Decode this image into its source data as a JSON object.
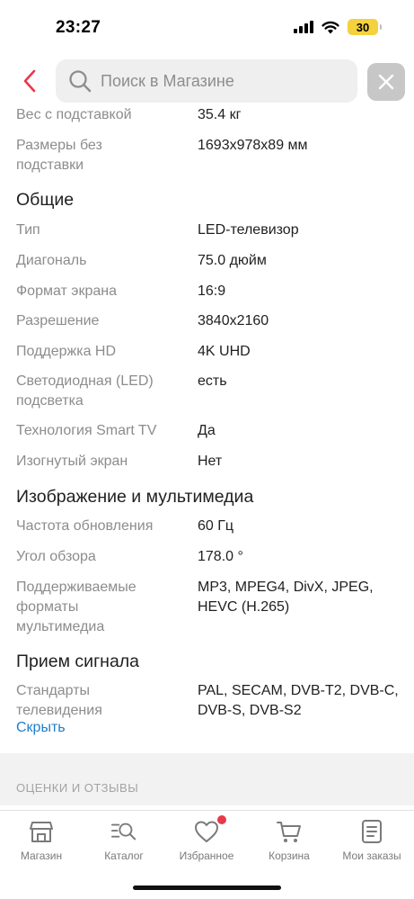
{
  "status_bar": {
    "time": "23:27",
    "battery": "30"
  },
  "header": {
    "search_placeholder": "Поиск в Магазине"
  },
  "specs_top": [
    {
      "label": "Вес с подставкой",
      "value": "35.4 кг"
    },
    {
      "label": "Размеры без подставки",
      "value": "1693x978x89 мм"
    }
  ],
  "sections": [
    {
      "title": "Общие",
      "rows": [
        {
          "label": "Тип",
          "value": "LED-телевизор"
        },
        {
          "label": "Диагональ",
          "value": "75.0 дюйм"
        },
        {
          "label": "Формат экрана",
          "value": "16:9"
        },
        {
          "label": "Разрешение",
          "value": "3840x2160"
        },
        {
          "label": "Поддержка HD",
          "value": "4K UHD"
        },
        {
          "label": "Светодиодная (LED) подсветка",
          "value": "есть"
        },
        {
          "label": "Технология Smart TV",
          "value": "Да"
        },
        {
          "label": "Изогнутый экран",
          "value": "Нет"
        }
      ]
    },
    {
      "title": "Изображение и мультимедиа",
      "rows": [
        {
          "label": "Частота обновления",
          "value": "60 Гц"
        },
        {
          "label": "Угол обзора",
          "value": "178.0 °"
        },
        {
          "label": "Поддерживаемые форматы мультимедиа",
          "value": "MP3, MPEG4, DivX, JPEG, HEVC (H.265)"
        }
      ]
    },
    {
      "title": "Прием сигнала",
      "rows": [
        {
          "label": "Стандарты телевидения",
          "value": "PAL, SECAM, DVB-T2, DVB-C, DVB-S, DVB-S2"
        }
      ]
    }
  ],
  "hide_link": "Скрыть",
  "reviews_title": "ОЦЕНКИ И ОТЗЫВЫ",
  "tab_bar": {
    "items": [
      {
        "label": "Магазин",
        "icon": "shop-icon"
      },
      {
        "label": "Каталог",
        "icon": "catalog-search-icon"
      },
      {
        "label": "Избранное",
        "icon": "heart-icon"
      },
      {
        "label": "Корзина",
        "icon": "cart-icon"
      },
      {
        "label": "Мои заказы",
        "icon": "orders-icon"
      }
    ]
  },
  "colors": {
    "accent_red": "#e8394a",
    "link_blue": "#1e7fc9"
  }
}
